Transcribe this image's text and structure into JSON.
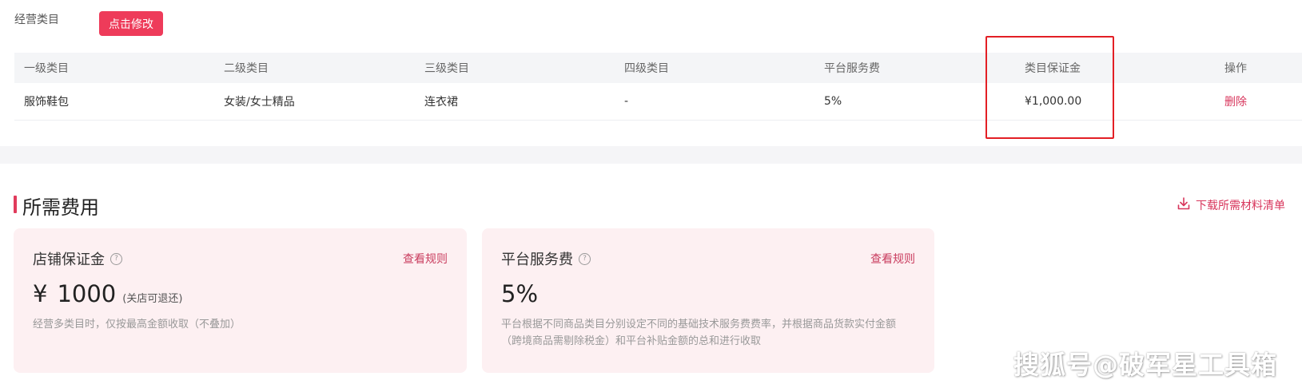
{
  "business_category": {
    "label": "经营类目",
    "modify_button": "点击修改"
  },
  "table": {
    "headers": [
      "一级类目",
      "二级类目",
      "三级类目",
      "四级类目",
      "平台服务费",
      "类目保证金",
      "操作"
    ],
    "rows": [
      [
        "服饰鞋包",
        "女装/女士精品",
        "连衣裙",
        "-",
        "5%",
        "¥1,000.00",
        "删除"
      ]
    ]
  },
  "fees": {
    "title": "所需费用",
    "download_label": "下载所需材料清单",
    "cards": [
      {
        "title": "店铺保证金",
        "rule_link": "查看规则",
        "currency": "¥",
        "value": "1000",
        "value_note": "(关店可退还)",
        "description": "经营多类目时，仅按最高金额收取（不叠加）"
      },
      {
        "title": "平台服务费",
        "rule_link": "查看规则",
        "value": "5%",
        "description": "平台根据不同商品类目分别设定不同的基础技术服务费费率，并根据商品货款实付金额（跨境商品需剔除税金）和平台补贴金额的总和进行收取"
      }
    ]
  },
  "watermark": "搜狐号@破军星工具箱",
  "colors": {
    "accent": "#ee3b5a",
    "link": "#d8365c",
    "highlight_box": "#e31f25",
    "card_bg": "#fdf0f2"
  },
  "icons": [
    "help-circle-icon",
    "download-icon"
  ]
}
